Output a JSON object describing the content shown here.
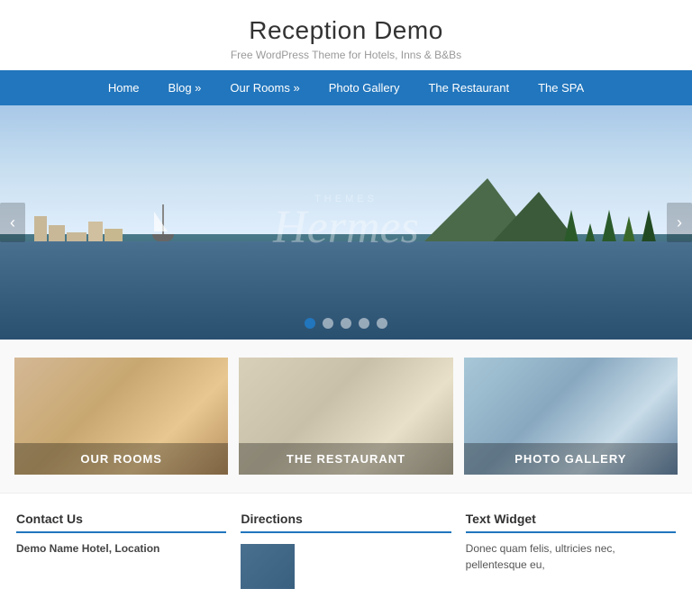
{
  "site": {
    "title": "Reception Demo",
    "tagline": "Free WordPress Theme for Hotels, Inns & B&Bs"
  },
  "nav": {
    "items": [
      {
        "label": "Home",
        "has_submenu": false
      },
      {
        "label": "Blog »",
        "has_submenu": true
      },
      {
        "label": "Our Rooms »",
        "has_submenu": true
      },
      {
        "label": "Photo Gallery",
        "has_submenu": false
      },
      {
        "label": "The Restaurant",
        "has_submenu": false
      },
      {
        "label": "The SPA",
        "has_submenu": false
      }
    ]
  },
  "hero": {
    "watermark_themes": "THEMES",
    "watermark_hermes": "Hermes",
    "arrow_left": "‹",
    "arrow_right": "›",
    "dots": [
      true,
      false,
      false,
      false,
      false
    ]
  },
  "features": [
    {
      "label": "OUR ROOMS",
      "bg_class": "feature-bg-rooms"
    },
    {
      "label": "THE RESTAURANT",
      "bg_class": "feature-bg-restaurant"
    },
    {
      "label": "PHOTO GALLERY",
      "bg_class": "feature-bg-gallery"
    }
  ],
  "widgets": [
    {
      "title": "Contact Us",
      "content": "Demo Name Hotel, Location"
    },
    {
      "title": "Directions",
      "content": ""
    },
    {
      "title": "Text Widget",
      "content": "Donec quam felis, ultricies nec, pellentesque eu,"
    }
  ]
}
